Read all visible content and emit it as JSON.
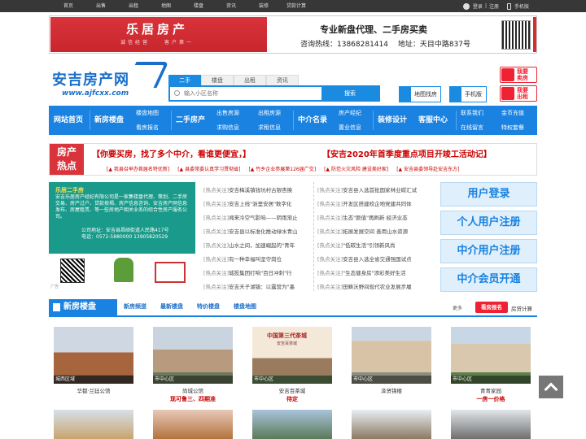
{
  "topbar": {
    "nav": [
      "首页",
      "出售",
      "出租",
      "地图",
      "楼盘",
      "资讯",
      "装修",
      "贷款计算"
    ],
    "login": "登录",
    "register": "注册",
    "separator": "|",
    "mobile": "手机版"
  },
  "banner": {
    "left_title": "乐居房产",
    "left_subtitle": "诚信经营　　客户第一",
    "slogan": "专业新盘代理、二手房买卖",
    "contact": "咨询热线：13868281414　 地址：天目中路837号"
  },
  "logo": {
    "name": "安吉房产网",
    "url": "www.ajfcxx.com"
  },
  "search": {
    "tabs": [
      "二手",
      "楼盘",
      "出租",
      "资讯"
    ],
    "placeholder": "输入小区名称",
    "button": "搜索"
  },
  "tools": {
    "map": "地图找房",
    "mobile": "手机版"
  },
  "actions": {
    "sell": "我要\n卖房",
    "rent": "我要\n出租",
    "sell_l1": "我要",
    "sell_l2": "卖房",
    "rent_l1": "我要",
    "rent_l2": "出租"
  },
  "nav": {
    "home": "网站首页",
    "newhouse": "新房楼盘",
    "map": "楼盘地图",
    "viewhouse": "看房报名",
    "second": "二手房产",
    "sale": "出售房源",
    "seek": "求购信息",
    "rent_out": "出租房源",
    "rent_seek": "求租信息",
    "agents": "中介名录",
    "agent_mgr": "房产经纪",
    "decor_info": "置业信息",
    "design": "装修设计",
    "service": "客服中心",
    "contact": "联系我们",
    "online": "在线留言",
    "gold": "金币充值",
    "special": "特权套餐"
  },
  "announce": {
    "label1": "房产",
    "label2": "热点",
    "headline1": "【你要买房，找了多个中介，看谁更便宜，】",
    "headline2": "【安吉2020年首季度重点项目开竣工活动记】",
    "links": [
      "[▲ 我县召举办首届名特优新]",
      "[▲ 县委常委认真学习贯彻省]",
      "[▲ 竹乡企业参展第126届广交]",
      "[▲ 防范火灾风险 建设美好家]",
      "[▲ 安吉县委领导赴安吉东方]"
    ]
  },
  "intro": {
    "heading": "乐居二手房",
    "body": "安吉乐居房产经纪有限公司是一家集楼盘代理、策划、二手房交易、房产过户、贷款按揭、房产信息咨询、安吉房产网信息发布、房屋租赁、等一些房地产相关业务的综合性房产服务公司。",
    "address": "公司地址：安吉县昌硕街道人民路417号",
    "phone": "电话：0572-5880000 13905820529",
    "ad": "广告"
  },
  "news_left": [
    {
      "tag": "[热点关注]",
      "text": "安吉梅溪镇钱坑村古银杏换"
    },
    {
      "tag": "[热点关注]",
      "text": "安吉上线\"浙里安居\"数字化"
    },
    {
      "tag": "[热点关注]",
      "text": "闻来冷空气影响——阴雨渐止"
    },
    {
      "tag": "[热点关注]",
      "text": "安吉县以标准化推动绿水青山"
    },
    {
      "tag": "[热点关注]",
      "text": "山水之间，加速崛起的\"青年"
    },
    {
      "tag": "[热点关注]",
      "text": "有一种幸福叫坚守岗位"
    },
    {
      "tag": "[热点关注]",
      "text": "城投集团打响\"百日冲刺\"行"
    },
    {
      "tag": "[热点关注]",
      "text": "安吉天子湖镇：以露营为\"墨"
    }
  ],
  "news_right": [
    {
      "tag": "[热点关注]",
      "text": "安吉县入选首批国家林业碳汇试"
    },
    {
      "tag": "[热点关注]",
      "text": "开发区搭建校企地党建共同体"
    },
    {
      "tag": "[热点关注]",
      "text": "生态\"颜值\"再刷新 经济业态"
    },
    {
      "tag": "[热点关注]",
      "text": "拓展发展空间 善用山水资源"
    },
    {
      "tag": "[热点关注]",
      "text": "\"低碳生活\"引领新风尚"
    },
    {
      "tag": "[热点关注]",
      "text": "安吉县入选全省交通强国试点"
    },
    {
      "tag": "[热点关注]",
      "text": "\"生态健身房\"添彩美好生活"
    },
    {
      "tag": "[热点关注]",
      "text": "田畴沃野间现代农业发展步履"
    }
  ],
  "register": {
    "user_login": "用户登录",
    "user_register": "个人用户注册",
    "agent_register": "中介用户注册",
    "agent_vip": "中介会员开通"
  },
  "section": {
    "title": "新房楼盘",
    "tabs": [
      "新房频道",
      "最新楼盘",
      "特价楼盘",
      "楼盘地图"
    ],
    "more": "更多",
    "apply": "看房报名",
    "calc": "房贷计算"
  },
  "properties": [
    {
      "district": "城西区域",
      "name": "华都·兰廷公馆",
      "price": ""
    },
    {
      "district": "市中心区",
      "name": "尚城公馆",
      "price": "现可鲁三、四期准"
    },
    {
      "district": "市中心区",
      "name": "安吉百茶城",
      "price": "待定"
    },
    {
      "district": "市中心区",
      "name": "泽贤锦楼",
      "price": ""
    },
    {
      "district": "市中心区",
      "name": "青青家园",
      "price": "一房一价格"
    }
  ],
  "property_images": {
    "p3_title": "中国第三代茶城",
    "p3_sub": "安吉百茶城"
  },
  "colors": {
    "brand_blue": "#1a82e0",
    "accent_red": "#d9333b",
    "intro_green": "#199a8a",
    "topbar": "#373737"
  }
}
